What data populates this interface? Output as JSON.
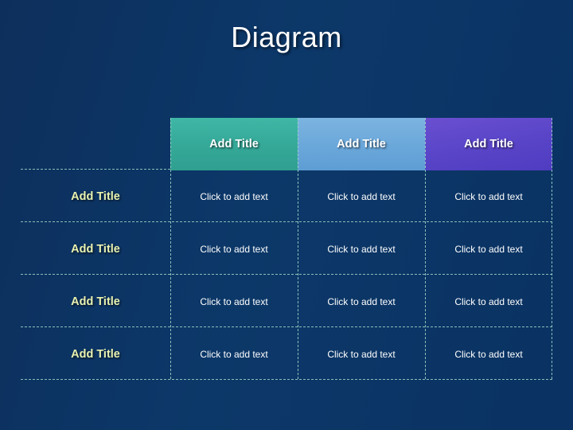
{
  "slide": {
    "title": "Diagram",
    "title_color": "#ffffff",
    "background_color": "#0a3060"
  },
  "matrix": {
    "corner_label": "",
    "column_headers": [
      {
        "label": "Add Title",
        "color": "#35a898"
      },
      {
        "label": "Add Title",
        "color": "#6aa7da"
      },
      {
        "label": "Add Title",
        "color": "#5a45c8"
      }
    ],
    "row_headers": [
      {
        "label": "Add Title"
      },
      {
        "label": "Add Title"
      },
      {
        "label": "Add Title"
      },
      {
        "label": "Add Title"
      }
    ],
    "rows": [
      [
        "Click to add text",
        "Click to add text",
        "Click to add text"
      ],
      [
        "Click to add text",
        "Click to add text",
        "Click to add text"
      ],
      [
        "Click to add text",
        "Click to add text",
        "Click to add text"
      ],
      [
        "Click to add text",
        "Click to add text",
        "Click to add text"
      ]
    ],
    "row_header_color": "#e9f2b0",
    "separator_color": "#9fd8c8"
  }
}
